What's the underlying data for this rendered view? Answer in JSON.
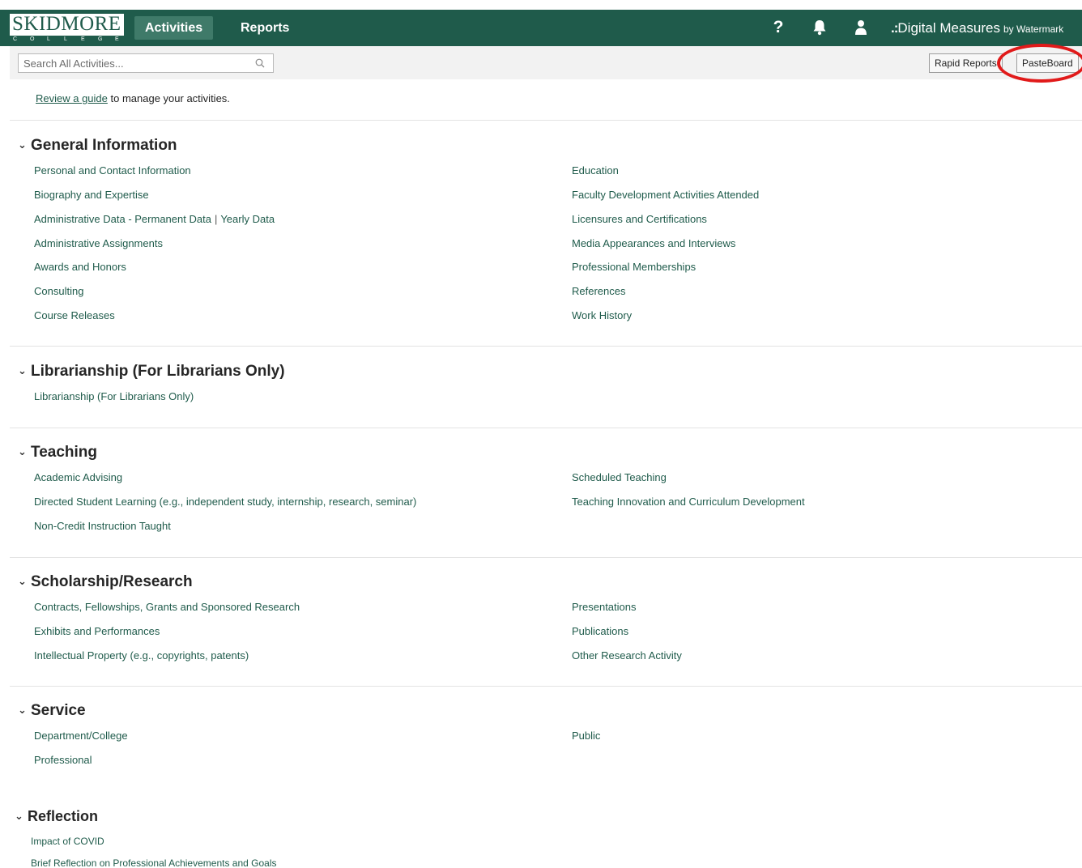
{
  "header": {
    "logo_word": "SKIDMORE",
    "logo_sub": [
      "C",
      "O",
      "L",
      "L",
      "E",
      "G",
      "E"
    ],
    "tabs": [
      {
        "label": "Activities",
        "active": true
      },
      {
        "label": "Reports",
        "active": false
      }
    ],
    "help_symbol": "?",
    "brand_dots": ".:",
    "brand_name": "Digital Measures",
    "brand_by": "by Watermark"
  },
  "toolbar": {
    "search_placeholder": "Search All Activities...",
    "rapid_reports_label": "Rapid Reports",
    "pasteboard_label": "PasteBoard"
  },
  "guide": {
    "link_text": "Review a guide",
    "rest_text": " to manage your activities."
  },
  "sections": {
    "general": {
      "title": "General Information",
      "left": [
        "Personal and Contact Information",
        "Biography and Expertise",
        "Administrative Data - Permanent Data",
        "Administrative Assignments",
        "Awards and Honors",
        "Consulting",
        "Course Releases"
      ],
      "admin_yearly": "Yearly Data",
      "right": [
        "Education",
        "Faculty Development Activities Attended",
        "Licensures and Certifications",
        "Media Appearances and Interviews",
        "Professional Memberships",
        "References",
        "Work History"
      ]
    },
    "librarianship": {
      "title": "Librarianship (For Librarians Only)",
      "left": [
        "Librarianship (For Librarians Only)"
      ]
    },
    "teaching": {
      "title": "Teaching",
      "left": [
        "Academic Advising",
        "Directed Student Learning (e.g., independent study, internship, research, seminar)",
        "Non-Credit Instruction Taught"
      ],
      "right": [
        "Scheduled Teaching",
        "Teaching Innovation and Curriculum Development"
      ]
    },
    "scholarship": {
      "title": "Scholarship/Research",
      "left": [
        "Contracts, Fellowships, Grants and Sponsored Research",
        "Exhibits and Performances",
        "Intellectual Property (e.g., copyrights, patents)"
      ],
      "right": [
        "Presentations",
        "Publications",
        "Other Research Activity"
      ]
    },
    "service": {
      "title": "Service",
      "left": [
        "Department/College",
        "Professional"
      ],
      "right": [
        "Public"
      ]
    },
    "reflection": {
      "title": "Reflection",
      "left": [
        "Impact of COVID",
        "Brief Reflection on Professional Achievements and Goals"
      ]
    }
  },
  "colors": {
    "header_bg": "#1f5b4b",
    "link": "#1f5b4b",
    "highlight": "#e11a1a"
  },
  "icons": {
    "help": "question-icon",
    "notifications": "bell-icon",
    "profile": "user-icon",
    "search": "search-icon",
    "section_toggle": "chevron-down-icon"
  }
}
